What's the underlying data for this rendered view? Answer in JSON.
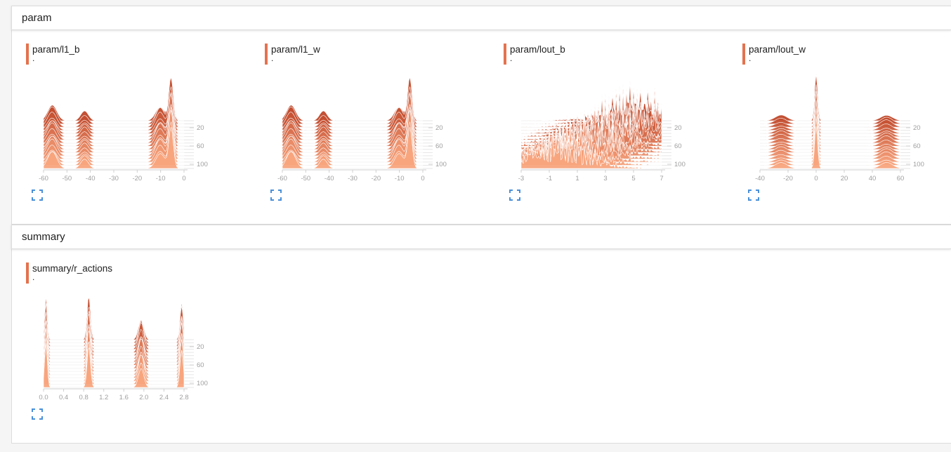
{
  "colors": {
    "accent": "#e3734f",
    "ridge_dark": "#c0482a",
    "ridge_light": "#f8a57e",
    "icon_blue": "#4a90d9"
  },
  "sections": [
    {
      "title": "param",
      "cards": [
        {
          "title": "param/l1_b",
          "subtitle": ".",
          "chart_data": {
            "type": "area",
            "x_ticks": [
              "-60",
              "-50",
              "-40",
              "-30",
              "-20",
              "-10",
              "0"
            ],
            "y_ticks": [
              "20",
              "60",
              "100"
            ],
            "xlim": [
              -60,
              5
            ],
            "peaks": [
              {
                "center": -56,
                "width": 3,
                "height": 0.35
              },
              {
                "center": -41,
                "width": 2.5,
                "height": 0.2
              },
              {
                "center": -6,
                "width": 3,
                "height": 0.4
              },
              {
                "center": -1,
                "width": 1.5,
                "height": 1.0
              }
            ]
          }
        },
        {
          "title": "param/l1_w",
          "subtitle": ".",
          "chart_data": {
            "type": "area",
            "x_ticks": [
              "-60",
              "-50",
              "-40",
              "-30",
              "-20",
              "-10",
              "0"
            ],
            "y_ticks": [
              "20",
              "60",
              "100"
            ],
            "xlim": [
              -60,
              5
            ],
            "peaks": [
              {
                "center": -56,
                "width": 3,
                "height": 0.35
              },
              {
                "center": -41,
                "width": 2.5,
                "height": 0.2
              },
              {
                "center": -6,
                "width": 3,
                "height": 0.4
              },
              {
                "center": -1,
                "width": 1.5,
                "height": 1.0
              }
            ]
          }
        },
        {
          "title": "param/lout_b",
          "subtitle": ".",
          "chart_data": {
            "type": "area",
            "x_ticks": [
              "-3",
              "-1",
              "1",
              "3",
              "5",
              "7"
            ],
            "y_ticks": [
              "20",
              "60",
              "100"
            ],
            "xlim": [
              -3,
              7
            ],
            "jagged": true
          }
        },
        {
          "title": "param/lout_w",
          "subtitle": ".",
          "chart_data": {
            "type": "area",
            "x_ticks": [
              "-40",
              "-20",
              "0",
              "20",
              "40",
              "60"
            ],
            "y_ticks": [
              "20",
              "60",
              "100"
            ],
            "xlim": [
              -40,
              60
            ],
            "peaks": [
              {
                "center": 0,
                "width": 1.5,
                "height": 1.0
              },
              {
                "center": -25,
                "width": 6,
                "height": 0.12
              },
              {
                "center": 50,
                "width": 6,
                "height": 0.15
              }
            ]
          }
        }
      ]
    },
    {
      "title": "summary",
      "cards": [
        {
          "title": "summary/r_actions",
          "subtitle": ".",
          "chart_data": {
            "type": "area",
            "x_ticks": [
              "0.0",
              "0.4",
              "0.8",
              "1.2",
              "1.6",
              "2.0",
              "2.4",
              "2.8"
            ],
            "y_ticks": [
              "20",
              "60",
              "100"
            ],
            "xlim": [
              0,
              2.95
            ],
            "peaks": [
              {
                "center": 0.05,
                "width": 0.04,
                "height": 0.95
              },
              {
                "center": 0.95,
                "width": 0.05,
                "height": 0.9
              },
              {
                "center": 2.05,
                "width": 0.08,
                "height": 0.55
              },
              {
                "center": 2.9,
                "width": 0.05,
                "height": 0.85
              }
            ]
          }
        }
      ]
    }
  ]
}
